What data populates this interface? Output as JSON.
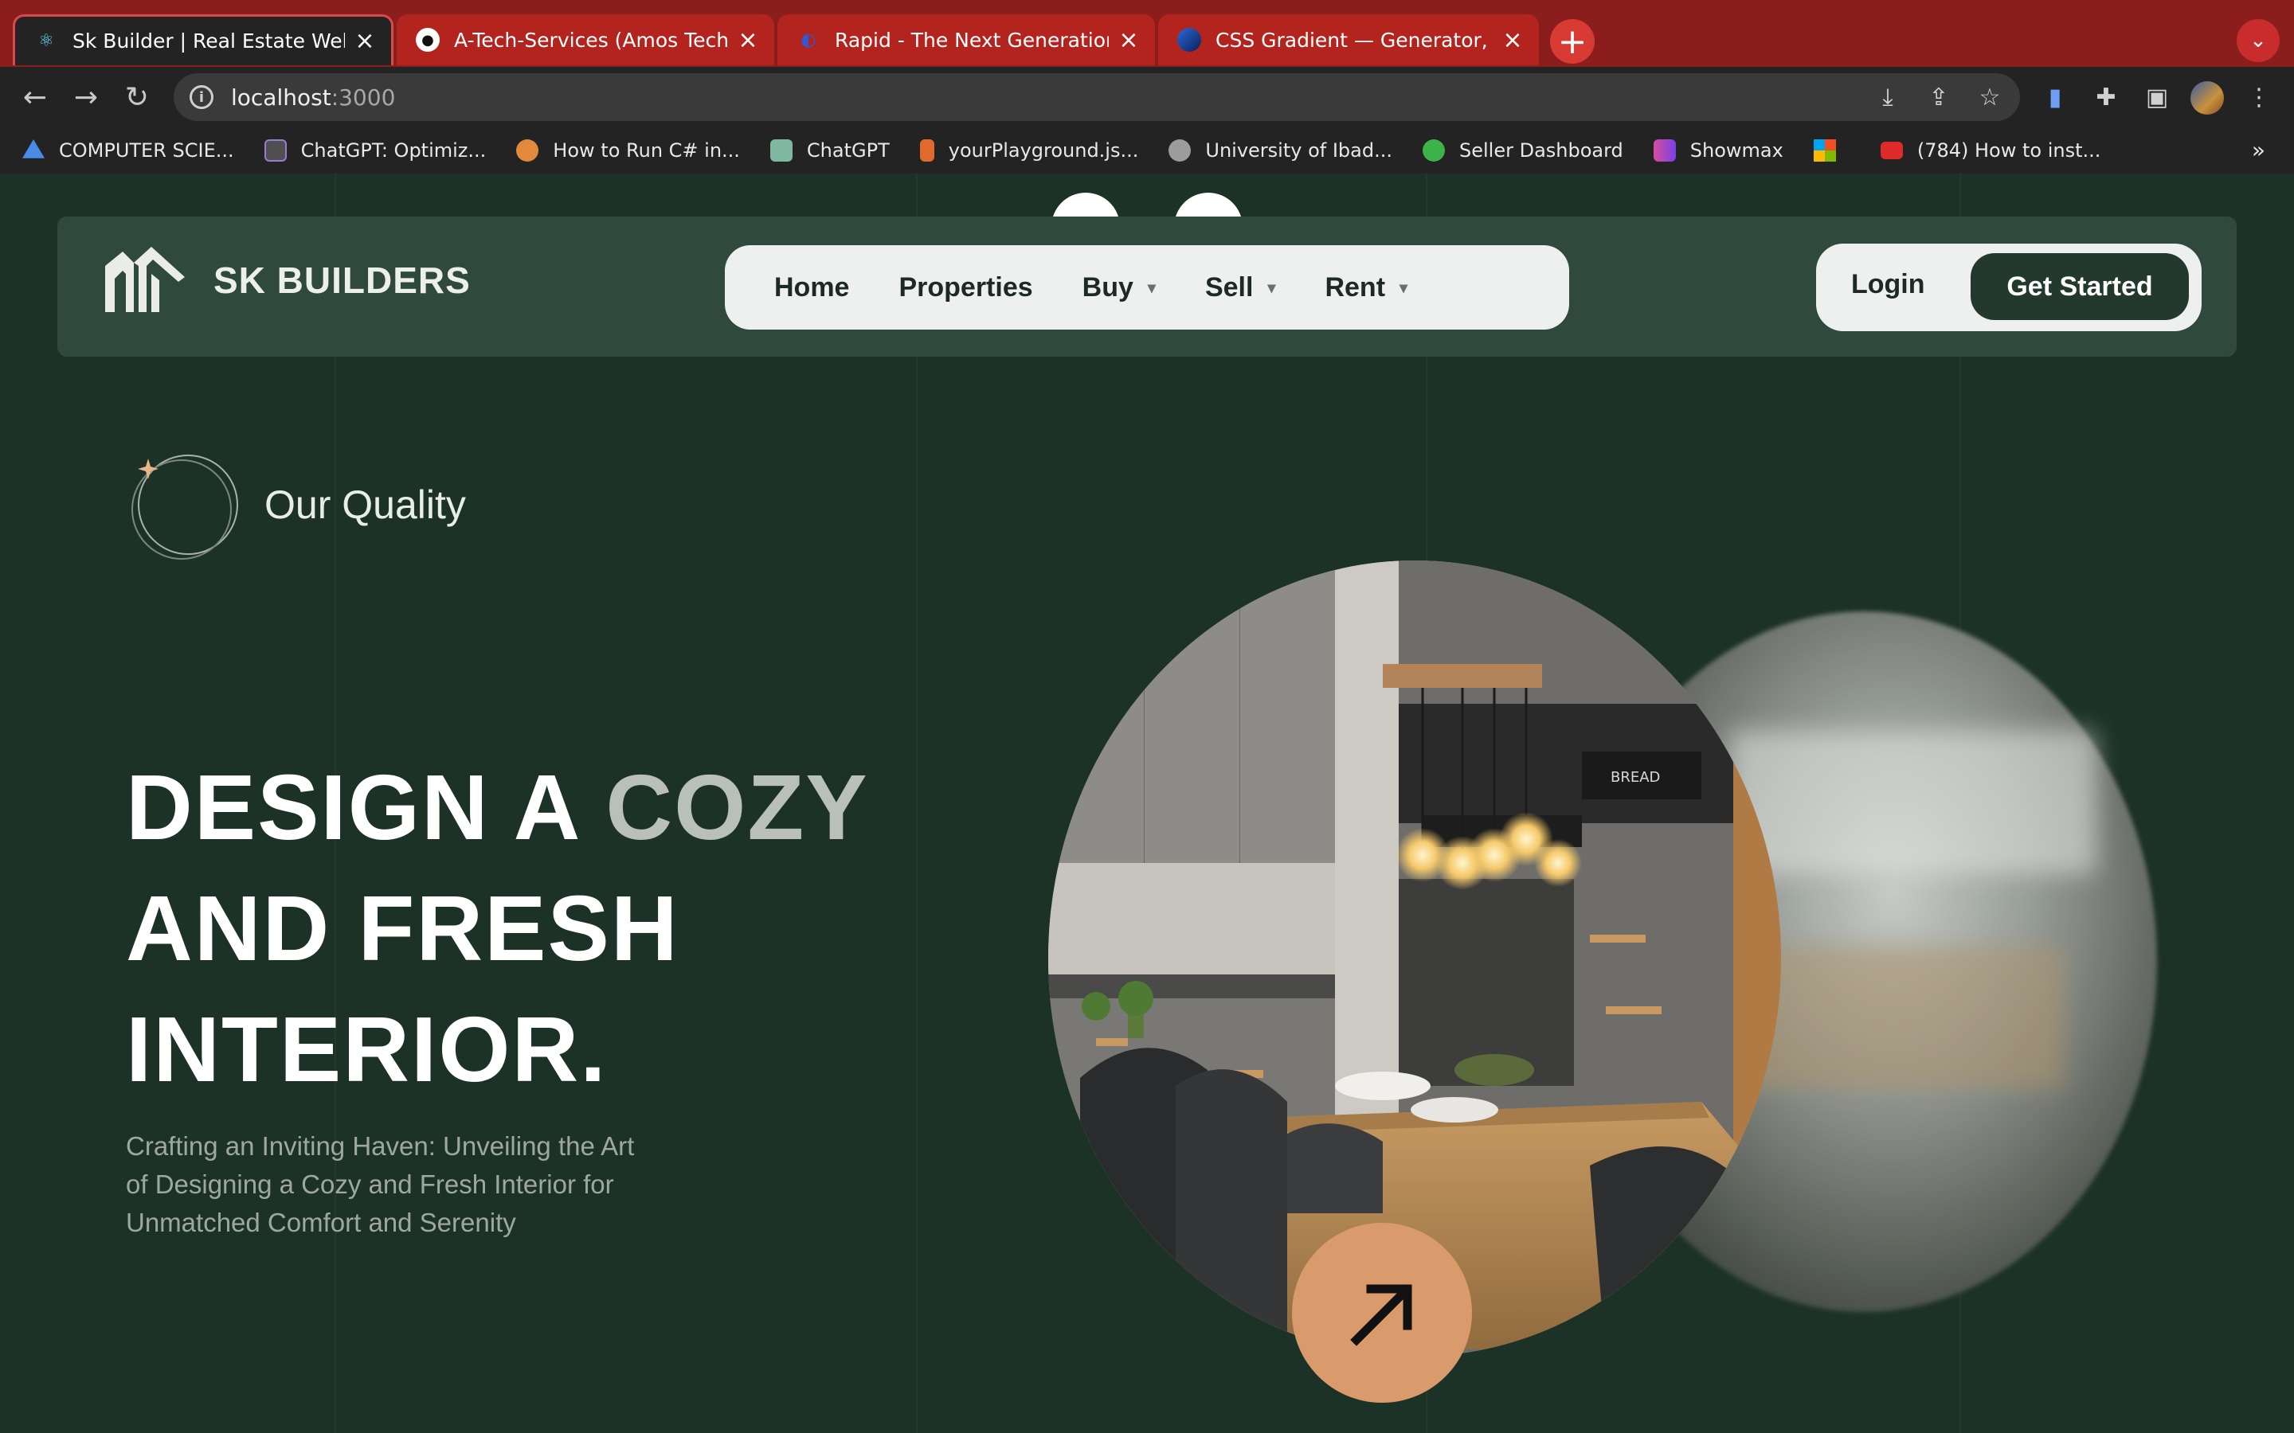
{
  "browser": {
    "tabs": [
      {
        "title": "Sk Builder | Real Estate Websit",
        "favicon": "react-icon",
        "active": true
      },
      {
        "title": "A-Tech-Services (Amos Tech)",
        "favicon": "github-icon",
        "active": false
      },
      {
        "title": "Rapid - The Next Generation A",
        "favicon": "rapid-icon",
        "active": false
      },
      {
        "title": "CSS Gradient — Generator, Ma",
        "favicon": "gradient-icon",
        "active": false
      }
    ],
    "new_tab": "+",
    "tab_menu": "⌄",
    "address": {
      "host": "localhost",
      "port": ":3000"
    },
    "bookmarks": [
      {
        "label": "COMPUTER SCIE...",
        "icon_color": "#4a8be8"
      },
      {
        "label": "ChatGPT: Optimiz...",
        "icon_color": "#9b7bd4"
      },
      {
        "label": "How to Run C# in...",
        "icon_color": "#e28a3c"
      },
      {
        "label": "ChatGPT",
        "icon_color": "#7fb8a0"
      },
      {
        "label": "yourPlayground.js...",
        "icon_color": "#e06a2c"
      },
      {
        "label": "University of Ibad...",
        "icon_color": "#9c9c9c"
      },
      {
        "label": "Seller Dashboard",
        "icon_color": "#3bb34a"
      },
      {
        "label": "Showmax",
        "icon_color": "#d94ea0"
      },
      {
        "label": "",
        "icon_color": "#f2b233"
      },
      {
        "label": "(784) How to inst...",
        "icon_color": "#e02a2a"
      }
    ],
    "bookmarks_more": "»"
  },
  "site": {
    "logo_text": "SK BUILDERS",
    "nav": {
      "home": "Home",
      "properties": "Properties",
      "buy": "Buy",
      "sell": "Sell",
      "rent": "Rent"
    },
    "login": "Login",
    "get_started": "Get Started",
    "quality_label": "Our Quality",
    "headline": {
      "line1_a": "DESIGN A ",
      "line1_b": "COZY",
      "line2": "AND FRESH",
      "line3": "INTERIOR."
    },
    "subtext": "Crafting an Inviting Haven: Unveiling the Art of Designing a Cozy and Fresh Interior for Unmatched Comfort and Serenity",
    "image_label": "BREAD",
    "colors": {
      "page_bg": "#1c3227",
      "navbar_bg": "#2f4a3c",
      "accent": "#d99a6c",
      "button_dark": "#24392e",
      "tab_strip": "#8c1d1d"
    }
  }
}
